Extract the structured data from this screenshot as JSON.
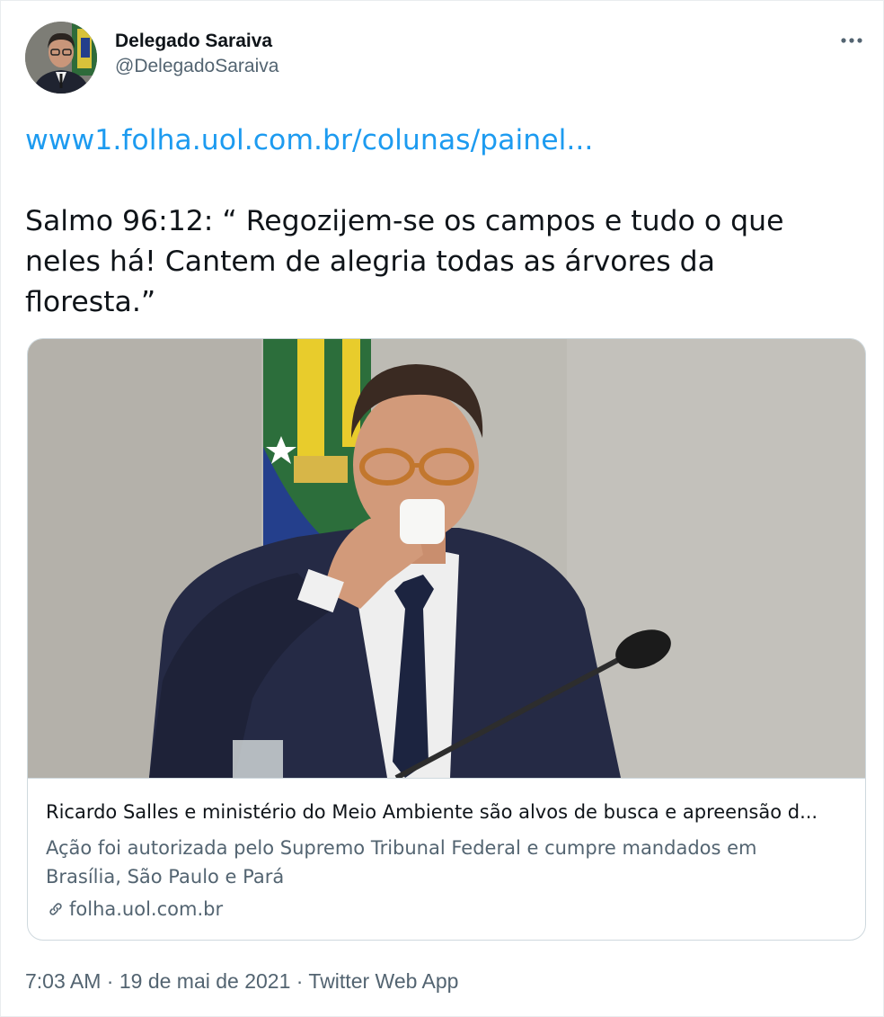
{
  "tweet": {
    "author": {
      "name": "Delegado Saraiva",
      "handle": "@DelegadoSaraiva"
    },
    "link": "www1.folha.uol.com.br/colunas/painel...",
    "body": "Salmo 96:12: “ Regozijem-se os campos e tudo o que neles há! Cantem de alegria todas as árvores da floresta.”",
    "card": {
      "title": "Ricardo Salles e ministério do Meio Ambiente são alvos de busca e apreensão d...",
      "description": "Ação foi autorizada pelo Supremo Tribunal Federal e cumpre mandados em Brasília, São Paulo e Pará",
      "domain": "folha.uol.com.br"
    },
    "meta": {
      "time": "7:03 AM",
      "separator": " · ",
      "date": "19 de mai de 2021",
      "source": "Twitter Web App"
    }
  },
  "colors": {
    "link": "#1d9bf0",
    "secondary": "#536471",
    "text": "#0f1419",
    "border": "#cfd9de"
  },
  "icons": [
    "more-options-icon",
    "link-chain-icon"
  ]
}
